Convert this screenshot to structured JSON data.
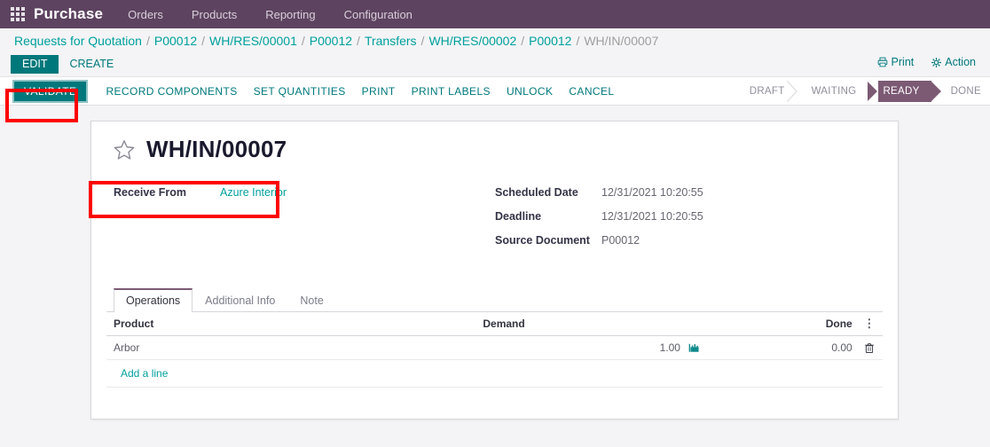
{
  "navbar": {
    "apps_icon": "apps-grid-icon",
    "brand": "Purchase",
    "menus": [
      "Orders",
      "Products",
      "Reporting",
      "Configuration"
    ]
  },
  "breadcrumb": {
    "separator": "/",
    "items": [
      {
        "label": "Requests for Quotation",
        "current": false
      },
      {
        "label": "P00012",
        "current": false
      },
      {
        "label": "WH/RES/00001",
        "current": false
      },
      {
        "label": "P00012",
        "current": false
      },
      {
        "label": "Transfers",
        "current": false
      },
      {
        "label": "WH/RES/00002",
        "current": false
      },
      {
        "label": "P00012",
        "current": false
      },
      {
        "label": "WH/IN/00007",
        "current": true
      }
    ]
  },
  "control_panel": {
    "edit_label": "EDIT",
    "create_label": "CREATE",
    "print_label": "Print",
    "print_icon": "printer-icon",
    "action_label": "Action",
    "action_icon": "gear-icon"
  },
  "action_buttons": {
    "validate_label": "VALIDATE",
    "others": [
      "RECORD COMPONENTS",
      "SET QUANTITIES",
      "PRINT",
      "PRINT LABELS",
      "UNLOCK",
      "CANCEL"
    ]
  },
  "status_pipeline": {
    "stages": [
      {
        "label": "DRAFT",
        "active": false
      },
      {
        "label": "WAITING",
        "active": false
      },
      {
        "label": "READY",
        "active": true
      },
      {
        "label": "DONE",
        "active": false
      }
    ],
    "active_color": "#7c5a74"
  },
  "record": {
    "favorite_icon": "star-outline-icon",
    "title": "WH/IN/00007",
    "fields_left": [
      {
        "label": "Receive From",
        "value": "Azure Interior",
        "is_link": true
      }
    ],
    "fields_right": [
      {
        "label": "Scheduled Date",
        "value": "12/31/2021 10:20:55",
        "is_link": false
      },
      {
        "label": "Deadline",
        "value": "12/31/2021 10:20:55",
        "is_link": false
      },
      {
        "label": "Source Document",
        "value": "P00012",
        "is_link": false
      }
    ]
  },
  "notebook": {
    "tabs": [
      {
        "label": "Operations",
        "active": true
      },
      {
        "label": "Additional Info",
        "active": false
      },
      {
        "label": "Note",
        "active": false
      }
    ]
  },
  "lines_table": {
    "columns": [
      "Product",
      "Demand",
      "Done"
    ],
    "optional_columns_icon": "vertical-dots-icon",
    "rows": [
      {
        "product": "Arbor",
        "demand": "1.00",
        "detail_icon": "detailed-operations-icon",
        "done": "0.00",
        "delete_icon": "trash-icon"
      }
    ],
    "add_line_label": "Add a line"
  },
  "annotations": {
    "color": "#ff0000",
    "boxes": [
      "validate-button-highlight",
      "receive-from-field-highlight"
    ]
  },
  "theme": {
    "navbar_bg": "#5d4360",
    "accent_teal": "#00787b",
    "link_teal": "#00a09d",
    "page_bg": "#f4f4f6",
    "sheet_bg": "#ffffff"
  }
}
